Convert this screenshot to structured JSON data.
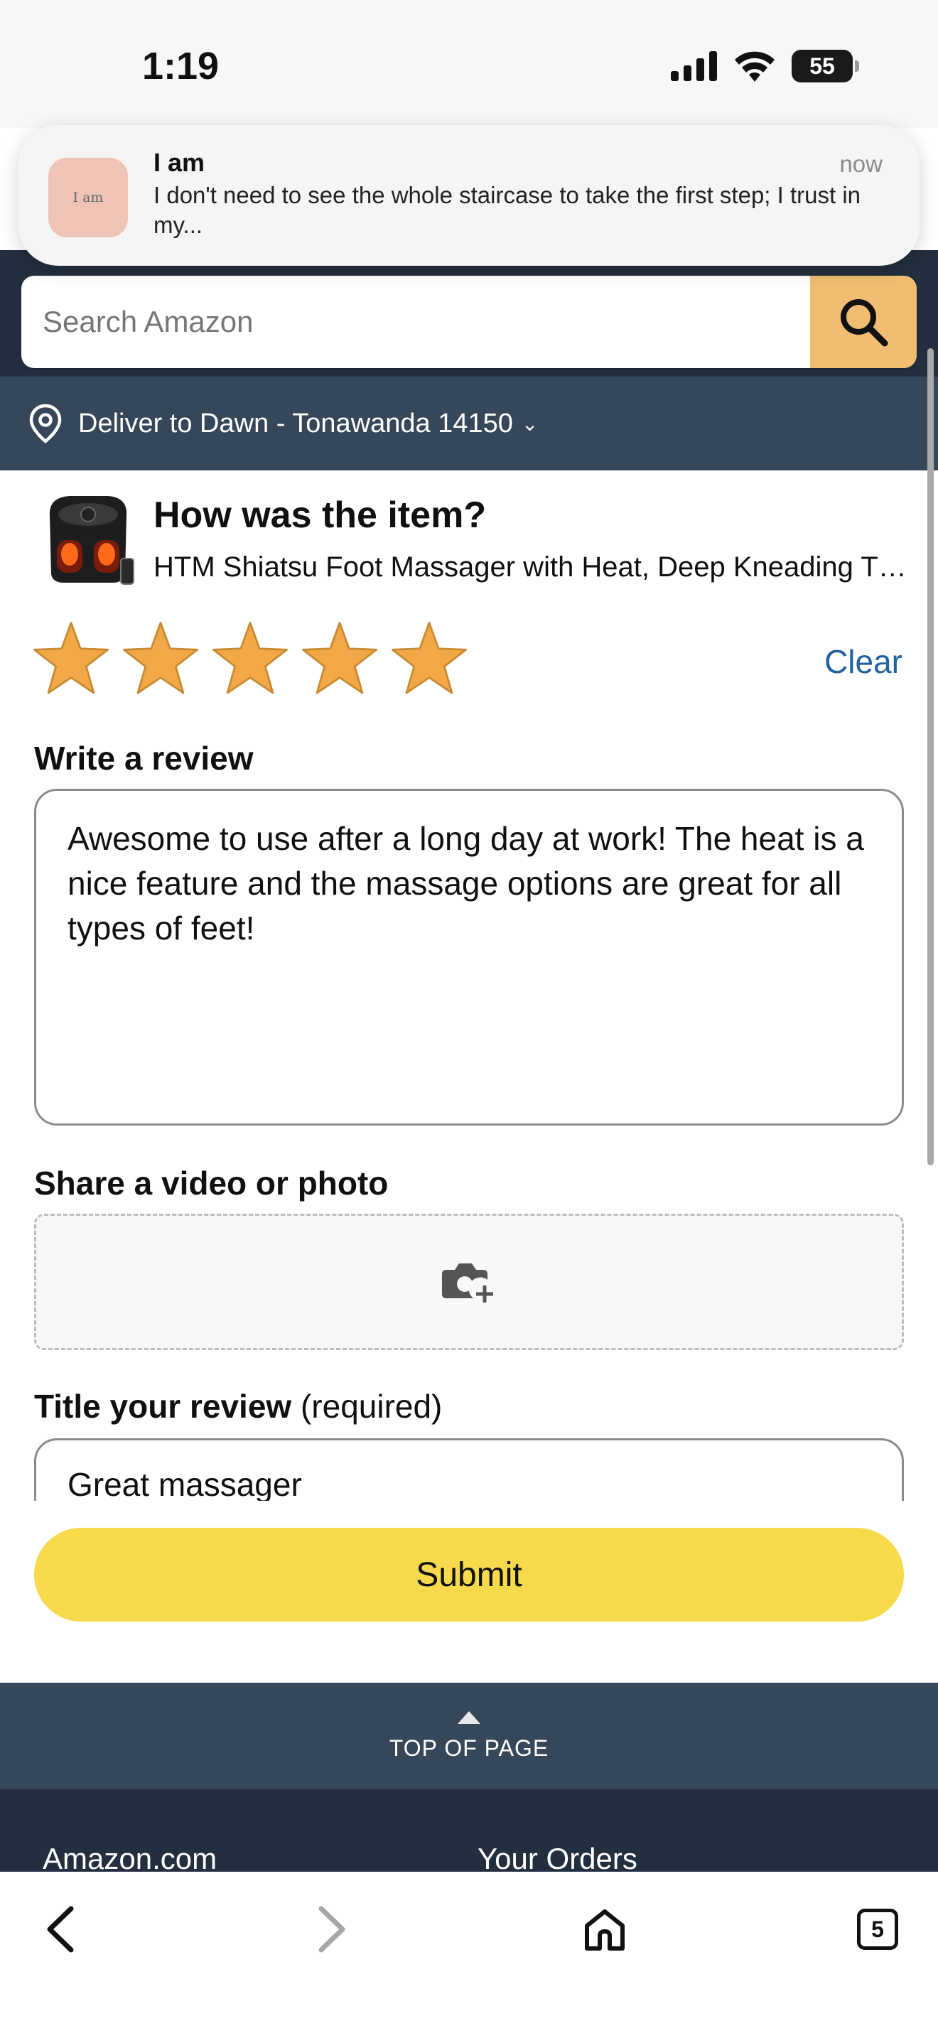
{
  "status_bar": {
    "time": "1:19",
    "battery": "55"
  },
  "notification": {
    "avatar_text": "I am",
    "title": "I am",
    "time": "now",
    "body": "I don't need to see the whole staircase to take the first step; I trust in my..."
  },
  "header": {
    "search_placeholder": "Search Amazon",
    "deliver_to": "Deliver to Dawn - Tonawanda 14150",
    "deliver_chevron": "⌄"
  },
  "product": {
    "question": "How was the item?",
    "name": "HTM Shiatsu Foot Massager with Heat, Deep Kneading Therapy, Air Compression"
  },
  "rating": {
    "stars": 5,
    "max": 5,
    "clear_label": "Clear"
  },
  "review": {
    "label": "Write a review",
    "text": "Awesome to use after a long day at work! The heat is a nice feature and the massage options are great for all types of feet!"
  },
  "media": {
    "label": "Share a video or photo"
  },
  "title_field": {
    "label": "Title your review",
    "required": "(required)",
    "value": "Great massager"
  },
  "submit_label": "Submit",
  "footer": {
    "top_label": "TOP OF PAGE",
    "link_left": "Amazon.com",
    "link_right": "Your Orders"
  },
  "browser": {
    "tab_count": "5"
  },
  "colors": {
    "header_dark": "#232f3e",
    "header_mid": "#37475a",
    "search_button": "#f0bd73",
    "star": "#f3a847",
    "link": "#2162a1",
    "submit": "#f7d94c"
  }
}
